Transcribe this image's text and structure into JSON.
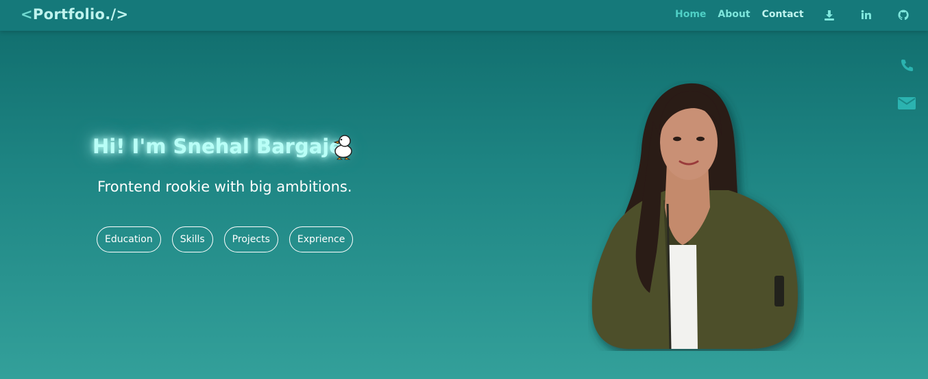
{
  "navbar": {
    "logo_open": "<",
    "logo_text": "Portfolio.",
    "logo_close": "/>",
    "links": [
      {
        "label": "Home"
      },
      {
        "label": "About"
      },
      {
        "label": "Contact"
      }
    ],
    "icons": [
      "download-icon",
      "linkedin-icon",
      "github-icon"
    ]
  },
  "side_contacts": [
    "phone-icon",
    "mail-icon"
  ],
  "hero": {
    "title": "Hi! I'm Snehal Bargaje.",
    "subtitle": "Frontend rookie with big ambitions.",
    "tags": [
      {
        "label": "Education"
      },
      {
        "label": "Skills"
      },
      {
        "label": "Projects"
      },
      {
        "label": "Exprience"
      }
    ]
  },
  "colors": {
    "nav_bg": "#15797a",
    "bg_top": "#0f6b6b",
    "bg_bottom": "#33a09a",
    "accent": "#4fd0c6",
    "title_glow": "#b9fff7"
  }
}
